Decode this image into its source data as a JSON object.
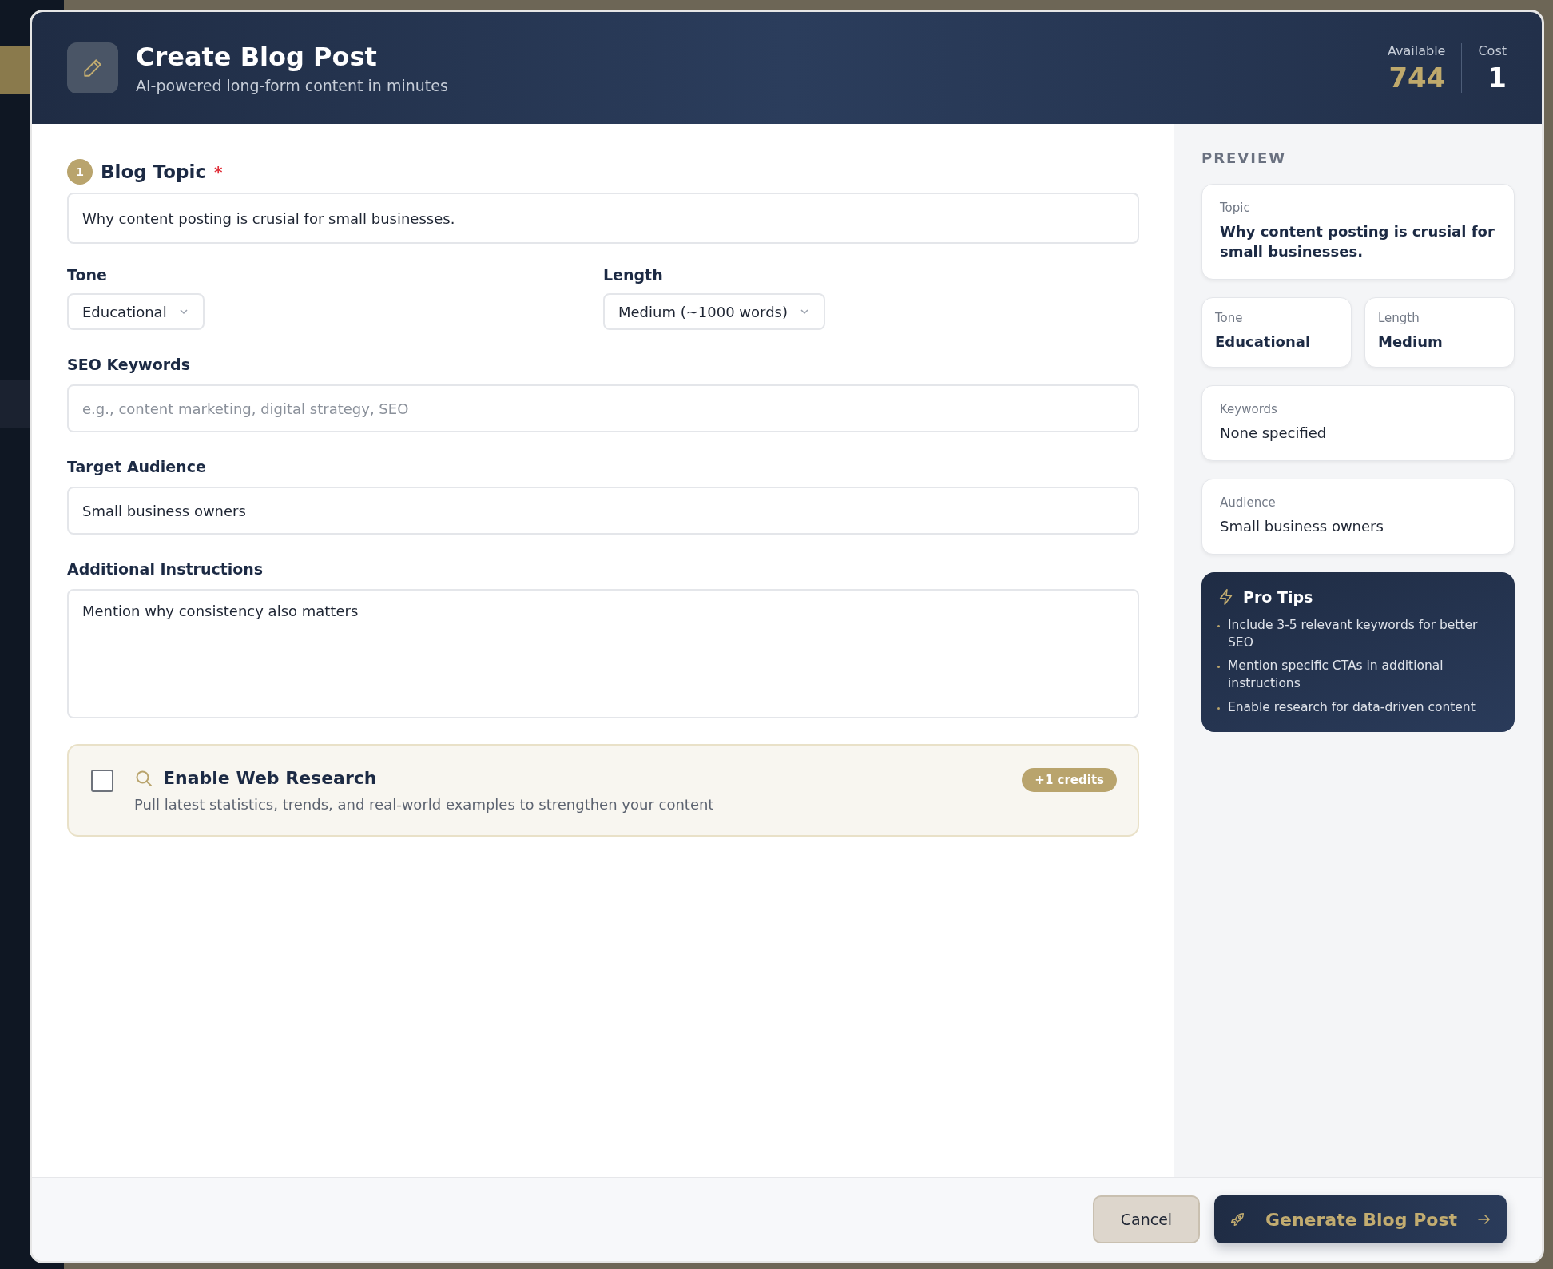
{
  "header": {
    "title": "Create Blog Post",
    "subtitle": "AI-powered long-form content in minutes",
    "stats": [
      {
        "label": "Available",
        "value": "744",
        "kind": "available"
      },
      {
        "label": "Cost",
        "value": "1",
        "kind": "cost"
      }
    ]
  },
  "form": {
    "topic": {
      "step": "1",
      "label": "Blog Topic",
      "required_mark": "*",
      "value": "Why content posting is crusial for small businesses."
    },
    "tone": {
      "label": "Tone",
      "value": "Educational"
    },
    "length": {
      "label": "Length",
      "value": "Medium (~1000 words)"
    },
    "keywords": {
      "label": "SEO Keywords",
      "placeholder": "e.g., content marketing, digital strategy, SEO"
    },
    "audience": {
      "label": "Target Audience",
      "value": "Small business owners"
    },
    "instructions": {
      "label": "Additional Instructions",
      "value": "Mention why consistency also matters"
    },
    "research": {
      "checked": false,
      "title": "Enable Web Research",
      "description": "Pull latest statistics, trends, and real-world examples to strengthen your content",
      "badge": "+1 credits"
    }
  },
  "preview": {
    "heading": "PREVIEW",
    "cards": [
      {
        "label": "Topic",
        "value": "Why content posting is crusial for small businesses.",
        "kind": "bold"
      },
      {
        "label": "Tone",
        "value": "Educational",
        "kind": "half"
      },
      {
        "label": "Length",
        "value": "Medium",
        "kind": "half"
      },
      {
        "label": "Keywords",
        "value": "None specified",
        "kind": "plain"
      },
      {
        "label": "Audience",
        "value": "Small business owners",
        "kind": "plain"
      }
    ]
  },
  "tips": {
    "title": "Pro Tips",
    "items": [
      "Include 3-5 relevant keywords for better SEO",
      "Mention specific CTAs in additional instructions",
      "Enable research for data-driven content"
    ]
  },
  "footer": {
    "cancel": "Cancel",
    "generate": "Generate Blog Post"
  }
}
